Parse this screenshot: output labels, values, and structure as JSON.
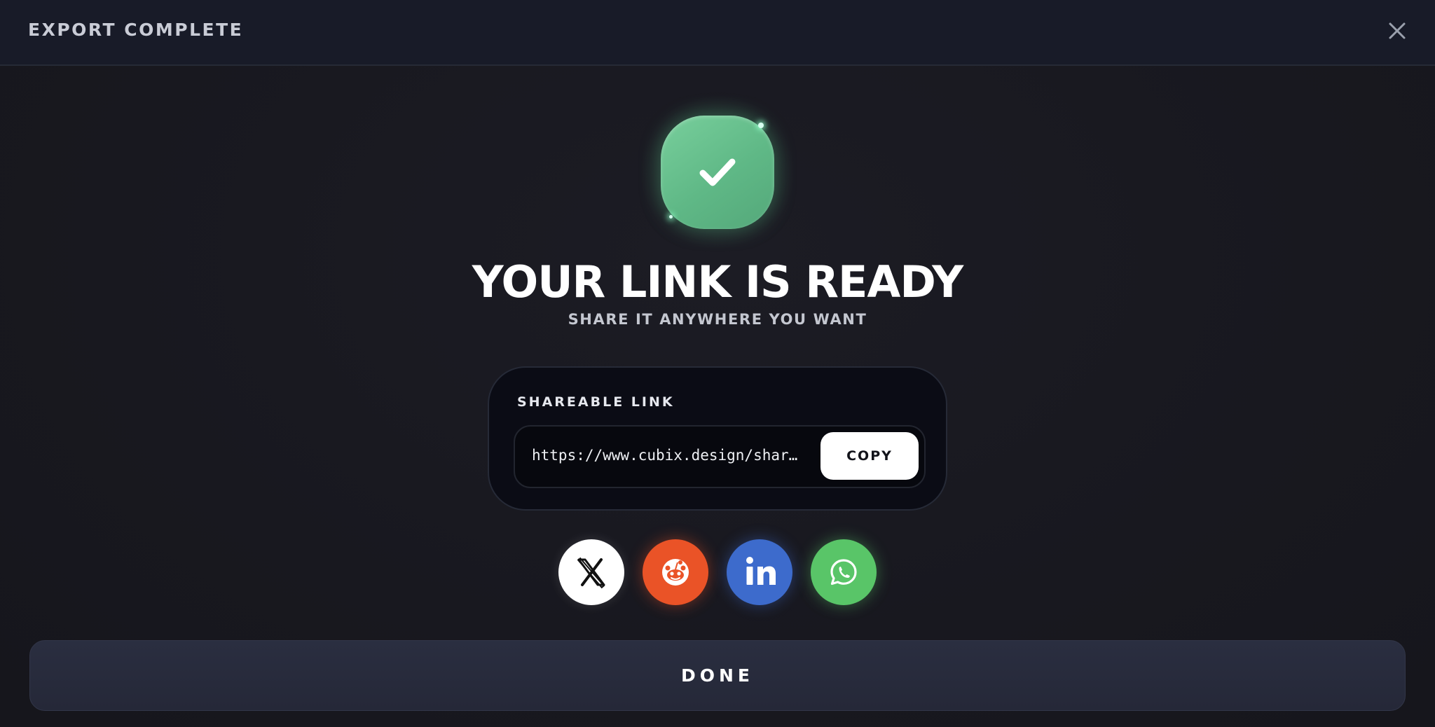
{
  "header": {
    "title": "EXPORT COMPLETE",
    "close_icon": "close-icon"
  },
  "success": {
    "icon": "check-icon",
    "accent_color": "#5fb886"
  },
  "main": {
    "title": "YOUR LINK IS READY",
    "subtitle": "SHARE IT ANYWHERE YOU WANT"
  },
  "link_card": {
    "label": "SHAREABLE LINK",
    "url": "https://www.cubix.design/shar…",
    "copy_label": "COPY"
  },
  "share": {
    "buttons": [
      {
        "name": "x",
        "icon": "x-logo-icon",
        "color": "#ffffff"
      },
      {
        "name": "reddit",
        "icon": "reddit-icon",
        "color": "#ea5327"
      },
      {
        "name": "linkedin",
        "icon": "linkedin-icon",
        "color": "#3d6bcc"
      },
      {
        "name": "whatsapp",
        "icon": "whatsapp-icon",
        "color": "#59c568"
      }
    ]
  },
  "footer": {
    "done_label": "DONE"
  }
}
